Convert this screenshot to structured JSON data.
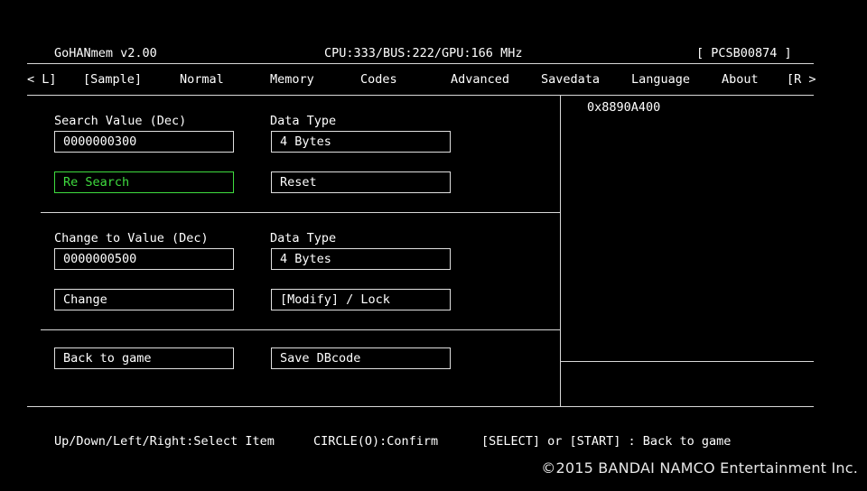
{
  "header": {
    "app_title": "GoHANmem v2.00",
    "clock_info": "CPU:333/BUS:222/GPU:166 MHz",
    "game_id": "[ PCSB00874 ]"
  },
  "tabs": {
    "prev": "< L]",
    "items": [
      "[Sample]",
      "Normal",
      "Memory",
      "Codes",
      "Advanced",
      "Savedata",
      "Language",
      "About"
    ],
    "next": "[R >"
  },
  "search": {
    "value_label": "Search Value (Dec)",
    "value": "0000000300",
    "type_label": "Data Type",
    "type_value": "4 Bytes",
    "re_search_label": "Re Search",
    "reset_label": "Reset"
  },
  "change": {
    "value_label": "Change to Value (Dec)",
    "value": "0000000500",
    "type_label": "Data Type",
    "type_value": "4 Bytes",
    "change_label": "Change",
    "mode_label": "[Modify] / Lock"
  },
  "actions": {
    "back_label": "Back to game",
    "save_label": "Save DBcode"
  },
  "results": {
    "address": "0x8890A400"
  },
  "footer": {
    "hint_nav": "Up/Down/Left/Right:Select Item",
    "hint_confirm": "CIRCLE(O):Confirm",
    "hint_back": "[SELECT] or [START] : Back to game",
    "copyright": "©2015 BANDAI NAMCO Entertainment Inc."
  },
  "colors": {
    "background": "#000000",
    "text": "#ffffff",
    "selected": "#3fdc3f"
  }
}
